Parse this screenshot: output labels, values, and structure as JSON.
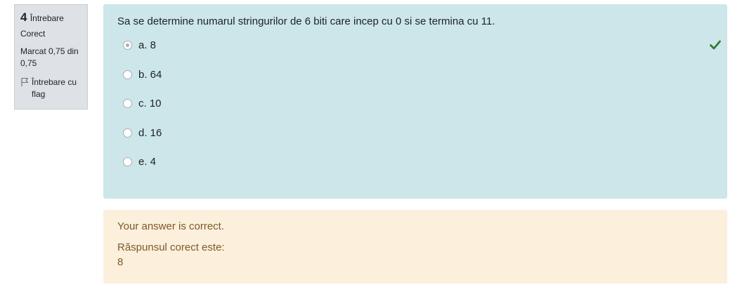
{
  "info": {
    "number": "4",
    "question_word": "Întrebare",
    "state": "Corect",
    "grade": "Marcat 0,75 din 0,75",
    "flag_label": "Întrebare cu flag"
  },
  "question": {
    "text": "Sa se determine numarul stringurilor de 6 biti care incep cu 0 si se termina cu 11.",
    "answers": [
      {
        "label": "a. 8",
        "selected": true,
        "correct": true
      },
      {
        "label": "b. 64",
        "selected": false
      },
      {
        "label": "c. 10",
        "selected": false
      },
      {
        "label": "d. 16",
        "selected": false
      },
      {
        "label": "e. 4",
        "selected": false
      }
    ]
  },
  "outcome": {
    "feedback": "Your answer is correct.",
    "right_answer_label": "Răspunsul corect este:",
    "right_answer_value": "8"
  },
  "colors": {
    "formulation_bg": "#cce6ea",
    "outcome_bg": "#fcefdc",
    "correct_icon": "#357a32"
  }
}
